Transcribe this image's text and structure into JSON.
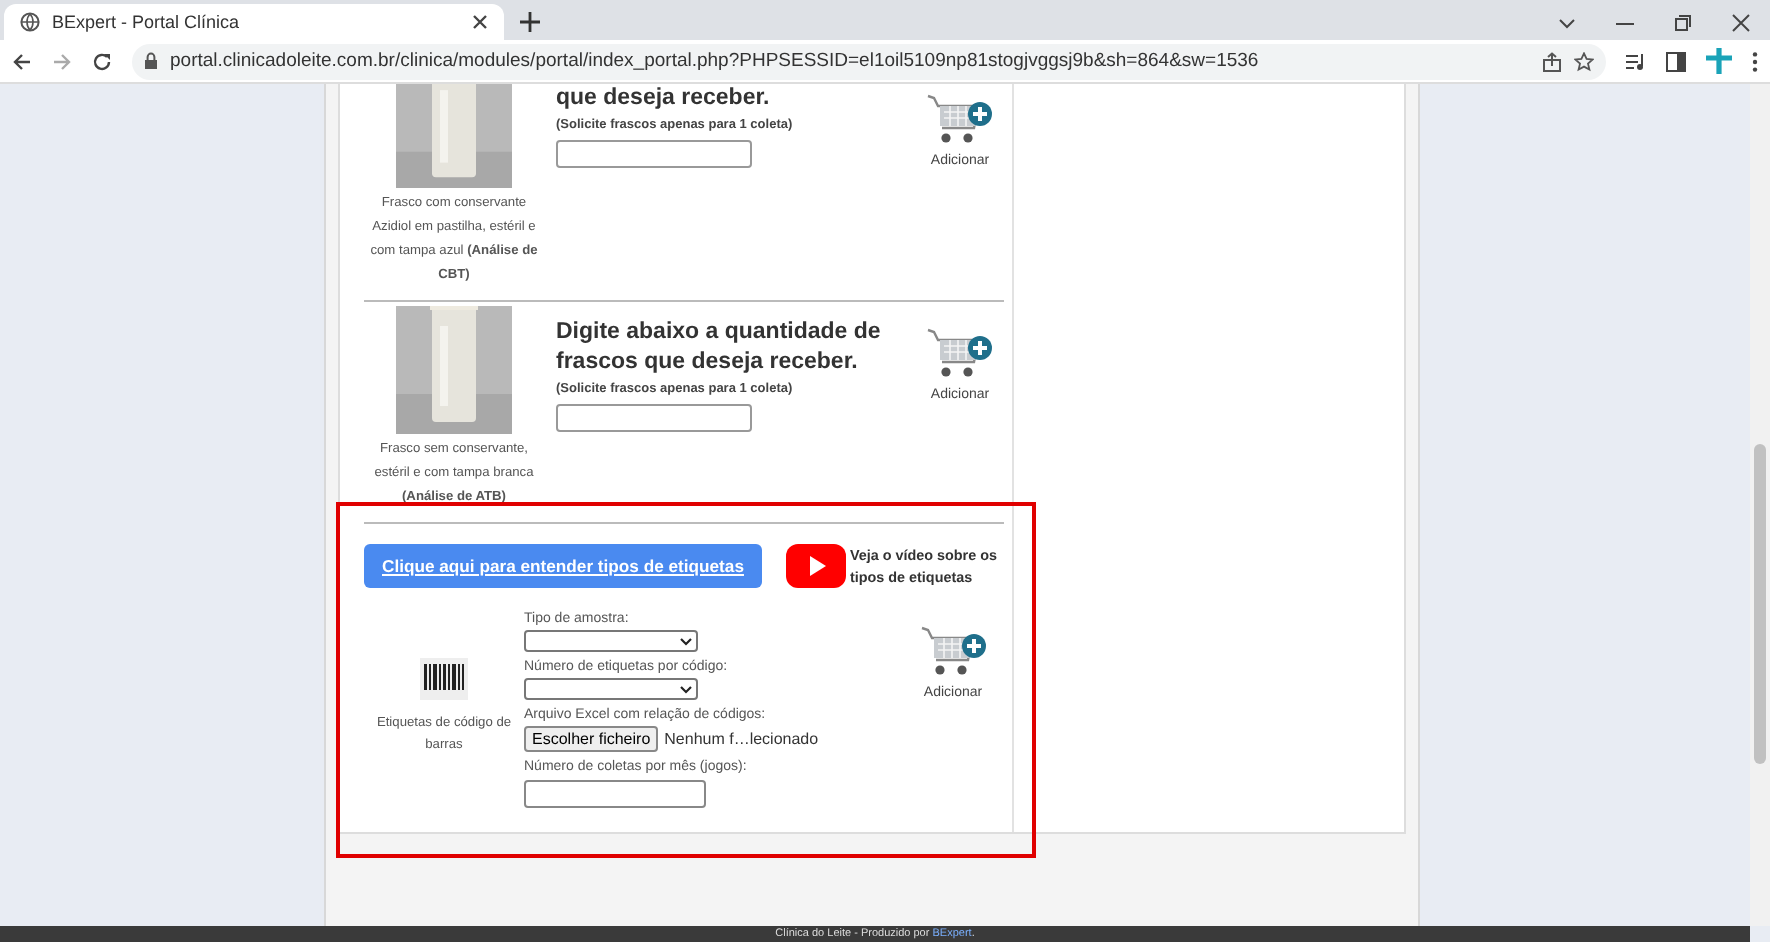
{
  "browser": {
    "tab_title": "BExpert - Portal Clínica",
    "url": "portal.clinicadoleite.com.br/clinica/modules/portal/index_portal.php?PHPSESSID=el1oil5109np81stogjvggsj9b&sh=864&sw=1536"
  },
  "products": [
    {
      "title": "que deseja receber.",
      "note": "(Solicite frascos apenas para 1 coleta)",
      "caption": "Frasco com conservante Azidiol em pastilha, estéril e com tampa azul **(Análise de CBT)**",
      "add_label": "Adicionar"
    },
    {
      "title": "Digite abaixo a quantidade de frascos que deseja receber.",
      "note": "(Solicite frascos apenas para 1 coleta)",
      "caption": "Frasco sem conservante, estéril e com tampa branca **(Análise de ATB)**",
      "add_label": "Adicionar"
    }
  ],
  "labels_section": {
    "help_button": "Clique aqui para entender tipos de etiquetas",
    "video_text": "Veja o vídeo sobre os tipos de etiquetas",
    "caption": "Etiquetas de código de barras",
    "fields": [
      {
        "kind": "select",
        "label": "Tipo de amostra:"
      },
      {
        "kind": "select",
        "label": "Número de etiquetas por código:"
      },
      {
        "kind": "file",
        "label": "Arquivo Excel com relação de códigos:",
        "button": "Escolher ficheiro",
        "status": "Nenhum f…lecionado"
      },
      {
        "kind": "text",
        "label": "Número de coletas por mês (jogos):"
      }
    ],
    "add_label": "Adicionar"
  },
  "footer": {
    "text": "Clínica do Leite - Produzido por",
    "link": "BExpert",
    "end": "."
  }
}
